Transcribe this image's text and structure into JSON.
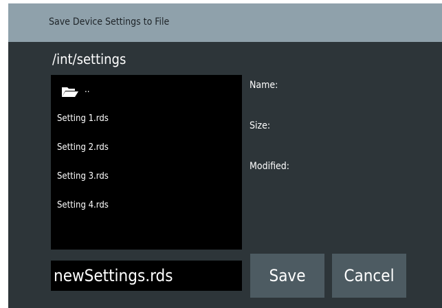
{
  "dialog": {
    "title": "Save Device Settings to File",
    "path": "/int/settings"
  },
  "file_list": {
    "parent_icon": "folder-open-icon",
    "parent_label": "..",
    "files": [
      "Setting 1.rds",
      "Setting 2.rds",
      "Setting 3.rds",
      "Setting 4.rds"
    ]
  },
  "info": {
    "name_label": "Name:",
    "size_label": "Size:",
    "modified_label": "Modified:"
  },
  "filename_input": {
    "value": "newSettings.rds"
  },
  "buttons": {
    "save_label": "Save",
    "cancel_label": "Cancel"
  },
  "colors": {
    "title_bar": "#8fa1ab",
    "dialog_background": "#2d3539",
    "list_background": "#000000",
    "button_background": "#4d5b62"
  }
}
